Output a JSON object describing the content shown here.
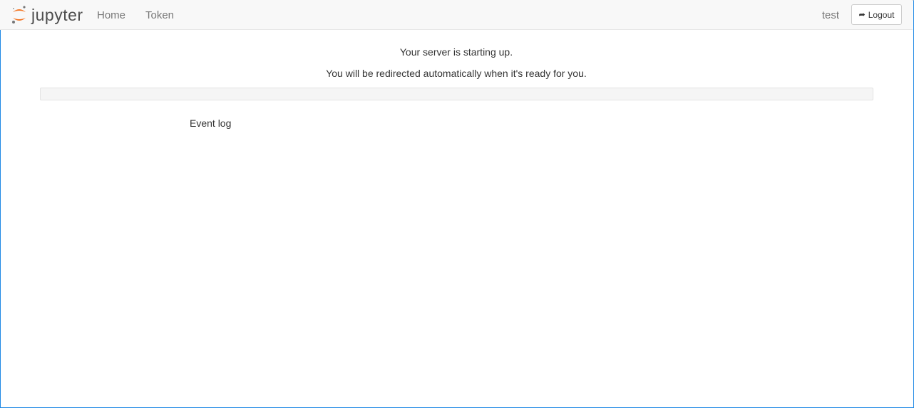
{
  "header": {
    "logo_text": "jupyter",
    "nav": [
      {
        "label": "Home"
      },
      {
        "label": "Token"
      }
    ],
    "user": "test",
    "logout_label": "Logout"
  },
  "main": {
    "status": "Your server is starting up.",
    "redirect": "You will be redirected automatically when it's ready for you.",
    "progress_percent": 0,
    "event_log_label": "Event log"
  },
  "colors": {
    "accent": "#f37726"
  }
}
